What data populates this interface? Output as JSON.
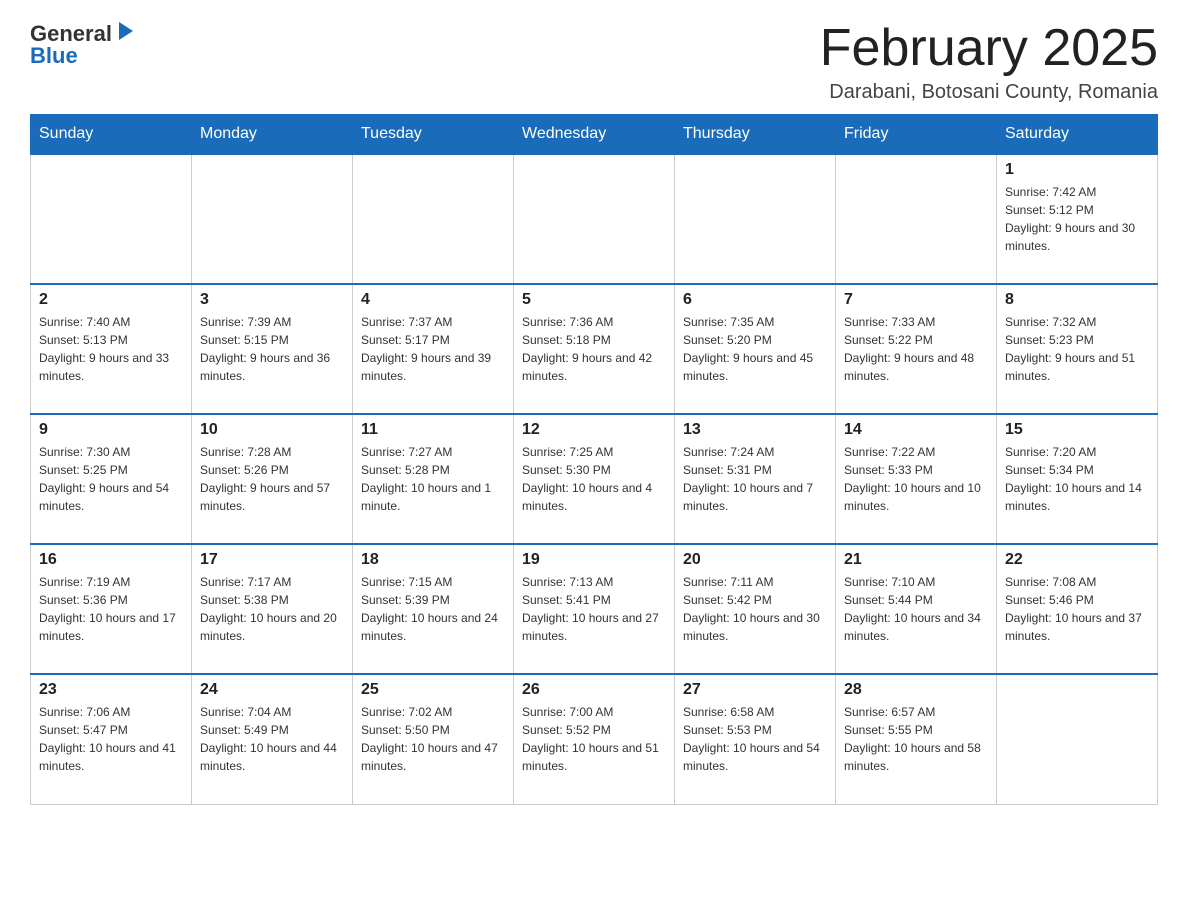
{
  "header": {
    "logo_general": "General",
    "logo_blue": "Blue",
    "month_title": "February 2025",
    "location": "Darabani, Botosani County, Romania"
  },
  "days_of_week": [
    "Sunday",
    "Monday",
    "Tuesday",
    "Wednesday",
    "Thursday",
    "Friday",
    "Saturday"
  ],
  "weeks": [
    [
      {
        "day": "",
        "info": ""
      },
      {
        "day": "",
        "info": ""
      },
      {
        "day": "",
        "info": ""
      },
      {
        "day": "",
        "info": ""
      },
      {
        "day": "",
        "info": ""
      },
      {
        "day": "",
        "info": ""
      },
      {
        "day": "1",
        "info": "Sunrise: 7:42 AM\nSunset: 5:12 PM\nDaylight: 9 hours and 30 minutes."
      }
    ],
    [
      {
        "day": "2",
        "info": "Sunrise: 7:40 AM\nSunset: 5:13 PM\nDaylight: 9 hours and 33 minutes."
      },
      {
        "day": "3",
        "info": "Sunrise: 7:39 AM\nSunset: 5:15 PM\nDaylight: 9 hours and 36 minutes."
      },
      {
        "day": "4",
        "info": "Sunrise: 7:37 AM\nSunset: 5:17 PM\nDaylight: 9 hours and 39 minutes."
      },
      {
        "day": "5",
        "info": "Sunrise: 7:36 AM\nSunset: 5:18 PM\nDaylight: 9 hours and 42 minutes."
      },
      {
        "day": "6",
        "info": "Sunrise: 7:35 AM\nSunset: 5:20 PM\nDaylight: 9 hours and 45 minutes."
      },
      {
        "day": "7",
        "info": "Sunrise: 7:33 AM\nSunset: 5:22 PM\nDaylight: 9 hours and 48 minutes."
      },
      {
        "day": "8",
        "info": "Sunrise: 7:32 AM\nSunset: 5:23 PM\nDaylight: 9 hours and 51 minutes."
      }
    ],
    [
      {
        "day": "9",
        "info": "Sunrise: 7:30 AM\nSunset: 5:25 PM\nDaylight: 9 hours and 54 minutes."
      },
      {
        "day": "10",
        "info": "Sunrise: 7:28 AM\nSunset: 5:26 PM\nDaylight: 9 hours and 57 minutes."
      },
      {
        "day": "11",
        "info": "Sunrise: 7:27 AM\nSunset: 5:28 PM\nDaylight: 10 hours and 1 minute."
      },
      {
        "day": "12",
        "info": "Sunrise: 7:25 AM\nSunset: 5:30 PM\nDaylight: 10 hours and 4 minutes."
      },
      {
        "day": "13",
        "info": "Sunrise: 7:24 AM\nSunset: 5:31 PM\nDaylight: 10 hours and 7 minutes."
      },
      {
        "day": "14",
        "info": "Sunrise: 7:22 AM\nSunset: 5:33 PM\nDaylight: 10 hours and 10 minutes."
      },
      {
        "day": "15",
        "info": "Sunrise: 7:20 AM\nSunset: 5:34 PM\nDaylight: 10 hours and 14 minutes."
      }
    ],
    [
      {
        "day": "16",
        "info": "Sunrise: 7:19 AM\nSunset: 5:36 PM\nDaylight: 10 hours and 17 minutes."
      },
      {
        "day": "17",
        "info": "Sunrise: 7:17 AM\nSunset: 5:38 PM\nDaylight: 10 hours and 20 minutes."
      },
      {
        "day": "18",
        "info": "Sunrise: 7:15 AM\nSunset: 5:39 PM\nDaylight: 10 hours and 24 minutes."
      },
      {
        "day": "19",
        "info": "Sunrise: 7:13 AM\nSunset: 5:41 PM\nDaylight: 10 hours and 27 minutes."
      },
      {
        "day": "20",
        "info": "Sunrise: 7:11 AM\nSunset: 5:42 PM\nDaylight: 10 hours and 30 minutes."
      },
      {
        "day": "21",
        "info": "Sunrise: 7:10 AM\nSunset: 5:44 PM\nDaylight: 10 hours and 34 minutes."
      },
      {
        "day": "22",
        "info": "Sunrise: 7:08 AM\nSunset: 5:46 PM\nDaylight: 10 hours and 37 minutes."
      }
    ],
    [
      {
        "day": "23",
        "info": "Sunrise: 7:06 AM\nSunset: 5:47 PM\nDaylight: 10 hours and 41 minutes."
      },
      {
        "day": "24",
        "info": "Sunrise: 7:04 AM\nSunset: 5:49 PM\nDaylight: 10 hours and 44 minutes."
      },
      {
        "day": "25",
        "info": "Sunrise: 7:02 AM\nSunset: 5:50 PM\nDaylight: 10 hours and 47 minutes."
      },
      {
        "day": "26",
        "info": "Sunrise: 7:00 AM\nSunset: 5:52 PM\nDaylight: 10 hours and 51 minutes."
      },
      {
        "day": "27",
        "info": "Sunrise: 6:58 AM\nSunset: 5:53 PM\nDaylight: 10 hours and 54 minutes."
      },
      {
        "day": "28",
        "info": "Sunrise: 6:57 AM\nSunset: 5:55 PM\nDaylight: 10 hours and 58 minutes."
      },
      {
        "day": "",
        "info": ""
      }
    ]
  ]
}
